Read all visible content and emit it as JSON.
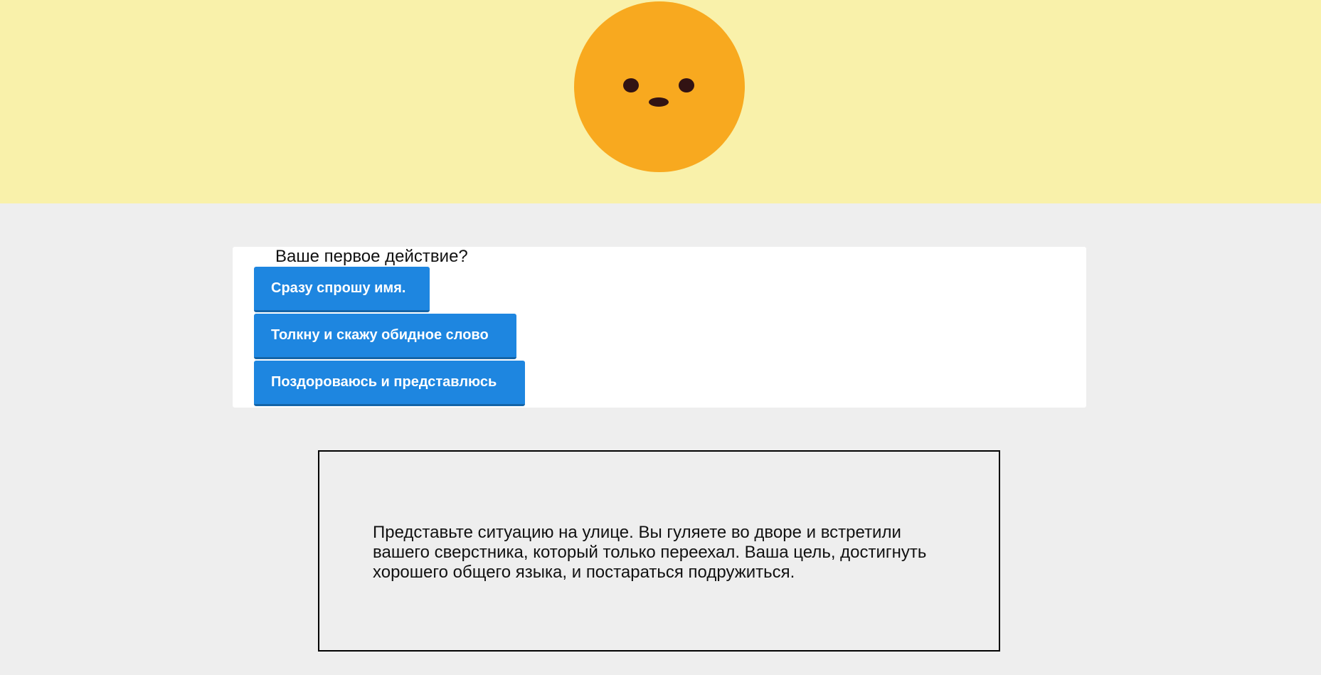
{
  "colors": {
    "banner_background": "#f9f1aa",
    "page_background": "#eeeeee",
    "character_body": "#f8a91f",
    "character_features": "#321313",
    "button_background": "#1e86e0",
    "button_text": "#ffffff"
  },
  "character": {
    "icon": "smiling-sun-face-icon"
  },
  "question": {
    "text": "Ваше первое действие?",
    "choices": [
      {
        "label": "Сразу спрошу имя."
      },
      {
        "label": "Толкну и скажу обидное слово"
      },
      {
        "label": "Поздороваюсь и представлюсь"
      }
    ]
  },
  "story": {
    "text": "Представьте ситуацию на улице. Вы гуляете во дворе и встретили вашего сверстника, который только переехал. Ваша цель, достигнуть хорошего общего языка, и постараться подружиться."
  }
}
